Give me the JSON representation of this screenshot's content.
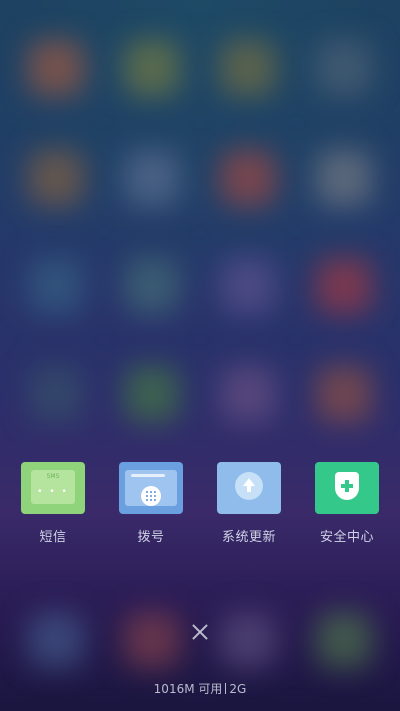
{
  "recent_apps": [
    {
      "id": "sms",
      "label": "短信",
      "icon": "sms-icon",
      "badge": "SMS",
      "dots": "• • •"
    },
    {
      "id": "dialer",
      "label": "拨号",
      "icon": "dialer-icon"
    },
    {
      "id": "update",
      "label": "系统更新",
      "icon": "system-update-icon"
    },
    {
      "id": "security",
      "label": "安全中心",
      "icon": "security-center-icon"
    }
  ],
  "memory": {
    "available": "1016M 可用",
    "total": "2G"
  },
  "colors": {
    "sms": "#8fd47a",
    "dialer": "#6a9fe0",
    "update": "#8fbcea",
    "security": "#34c98b"
  }
}
